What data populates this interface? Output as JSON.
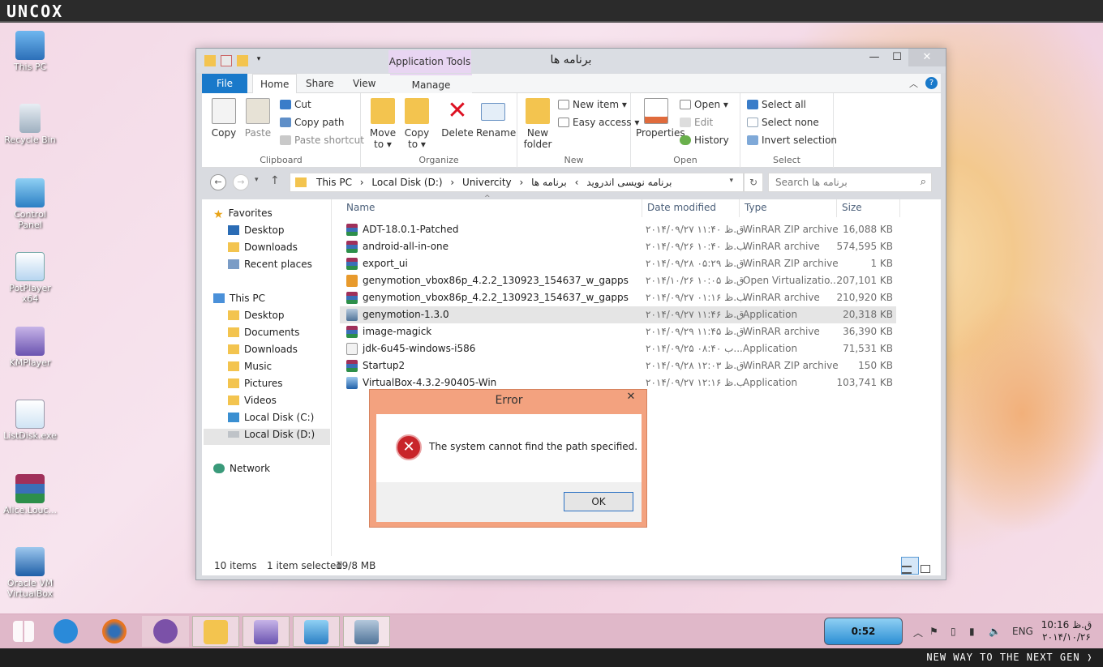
{
  "topbar": {
    "brand": "UNCOX"
  },
  "bottombar": {
    "slogan": "NEW WAY TO THE NEXT GEN ❭"
  },
  "desktop_icons": [
    {
      "label": "This PC",
      "icon": "computer-icon"
    },
    {
      "label": "Recycle Bin",
      "icon": "recycle-bin-icon"
    },
    {
      "label": "Control Panel",
      "icon": "control-panel-icon"
    },
    {
      "label": "PotPlayer x64",
      "icon": "shortcut-icon"
    },
    {
      "label": "KMPlayer",
      "icon": "kmplayer-icon"
    },
    {
      "label": "ListDisk.exe",
      "icon": "shortcut-icon"
    },
    {
      "label": "Alice.Louc...",
      "icon": "winrar-icon"
    },
    {
      "label": "Oracle VM VirtualBox",
      "icon": "virtualbox-icon"
    }
  ],
  "window": {
    "title": "برنامه ها",
    "app_tools": "Application Tools",
    "tabs": {
      "file": "File",
      "home": "Home",
      "share": "Share",
      "view": "View",
      "manage": "Manage"
    }
  },
  "ribbon": {
    "clipboard": {
      "label": "Clipboard",
      "copy": "Copy",
      "paste": "Paste",
      "cut": "Cut",
      "copy_path": "Copy path",
      "paste_shortcut": "Paste shortcut"
    },
    "organize": {
      "label": "Organize",
      "move_to": "Move to ▾",
      "copy_to": "Copy to ▾",
      "delete": "Delete",
      "rename": "Rename"
    },
    "new": {
      "label": "New",
      "new_folder": "New folder",
      "new_item": "New item ▾",
      "easy_access": "Easy access ▾"
    },
    "open": {
      "label": "Open",
      "properties": "Properties",
      "open": "Open ▾",
      "edit": "Edit",
      "history": "History"
    },
    "select": {
      "label": "Select",
      "select_all": "Select all",
      "select_none": "Select none",
      "invert": "Invert selection"
    }
  },
  "address": {
    "crumbs": [
      "This PC",
      "›",
      "Local Disk (D:)",
      "›",
      "Univercity",
      "›",
      "برنامه نویسی اندروید",
      "›",
      "برنامه ها"
    ],
    "search_placeholder": "Search برنامه ها"
  },
  "nav": {
    "favorites": "Favorites",
    "fav_items": [
      "Desktop",
      "Downloads",
      "Recent places"
    ],
    "this_pc": "This PC",
    "pc_items": [
      "Desktop",
      "Documents",
      "Downloads",
      "Music",
      "Pictures",
      "Videos",
      "Local Disk (C:)",
      "Local Disk (D:)"
    ],
    "network": "Network"
  },
  "columns": {
    "name": "Name",
    "date": "Date modified",
    "type": "Type",
    "size": "Size"
  },
  "files": [
    {
      "name": "ADT-18.0.1-Patched",
      "date": "۲۰۱۴/۰۹/۲۷ ق.ظ ۱۱:۴۰",
      "type": "WinRAR ZIP archive",
      "size": "16,088 KB",
      "icon": "winrar-icon"
    },
    {
      "name": "android-all-in-one",
      "date": "۲۰۱۴/۰۹/۲۶ ب.ظ ۱۰:۴۰",
      "type": "WinRAR archive",
      "size": "574,595 KB",
      "icon": "winrar-icon"
    },
    {
      "name": "export_ui",
      "date": "۲۰۱۴/۰۹/۲۸ ق.ظ ۰۵:۲۹",
      "type": "WinRAR ZIP archive",
      "size": "1 KB",
      "icon": "winrar-icon"
    },
    {
      "name": "genymotion_vbox86p_4.2.2_130923_154637_w_gapps",
      "date": "۲۰۱۴/۱۰/۲۶ ق.ظ ۱۰:۰۵",
      "type": "Open Virtualizatio...",
      "size": "207,101 KB",
      "icon": "ova-icon"
    },
    {
      "name": "genymotion_vbox86p_4.2.2_130923_154637_w_gapps",
      "date": "۲۰۱۴/۰۹/۲۷ ب.ظ ۰۱:۱۶",
      "type": "WinRAR archive",
      "size": "210,920 KB",
      "icon": "winrar-icon"
    },
    {
      "name": "genymotion-1.3.0",
      "date": "۲۰۱۴/۰۹/۲۷ ق.ظ ۱۱:۴۶",
      "type": "Application",
      "size": "20,318 KB",
      "icon": "installer-icon"
    },
    {
      "name": "image-magick",
      "date": "۲۰۱۴/۰۹/۲۹ ق.ظ ۱۱:۴۵",
      "type": "WinRAR archive",
      "size": "36,390 KB",
      "icon": "winrar-icon"
    },
    {
      "name": "jdk-6u45-windows-i586",
      "date": "۲۰۱۴/۰۹/۲۵ ب ۰۸:۴۰...",
      "type": "Application",
      "size": "71,531 KB",
      "icon": "java-icon"
    },
    {
      "name": "Startup2",
      "date": "۲۰۱۴/۰۹/۲۸ ق.ظ ۱۲:۰۳",
      "type": "WinRAR ZIP archive",
      "size": "150 KB",
      "icon": "winrar-icon"
    },
    {
      "name": "VirtualBox-4.3.2-90405-Win",
      "date": "۲۰۱۴/۰۹/۲۷ ب.ظ ۱۲:۱۶",
      "type": "Application",
      "size": "103,741 KB",
      "icon": "virtualbox-icon"
    }
  ],
  "status": {
    "items": "10 items",
    "selected": "1 item selected",
    "size": "19/8 MB"
  },
  "dialog": {
    "title": "Error",
    "message": "The system cannot find the path specified.",
    "ok": "OK"
  },
  "taskbar": {
    "meter": "0:52",
    "lang": "ENG",
    "time": "10:16 ق.ظ",
    "date": "۲۰۱۴/۱۰/۲۶"
  },
  "colors": {
    "file_tab": "#1979ca",
    "app_tools": "#e8d5f2",
    "dialog_frame": "#f3a27f",
    "error": "#c8242a",
    "taskbar": "#e0b8c9"
  }
}
